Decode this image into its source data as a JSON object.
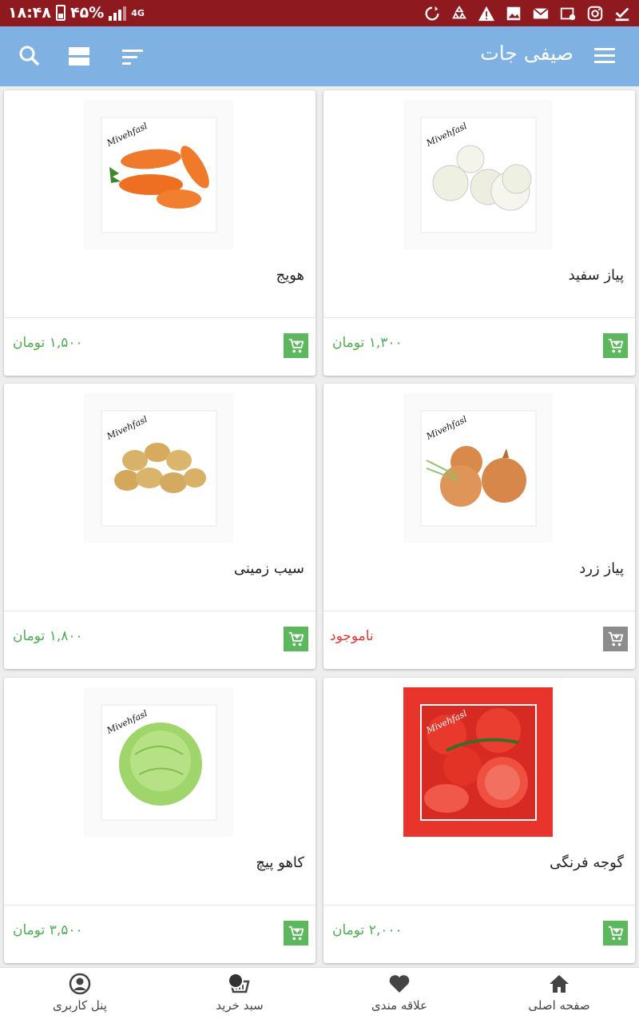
{
  "status_bar": {
    "time": "۱۸:۴۸",
    "battery": "۴۵%",
    "network": "4G"
  },
  "app_bar": {
    "title": "صیفی جات",
    "color": "#7fb2e2"
  },
  "products": [
    {
      "name": "هویج",
      "price": "۱,۵۰۰ تومان",
      "available": true,
      "watermark": "Mivehfasl",
      "icon": "carrot-image"
    },
    {
      "name": "پیاز سفید",
      "price": "۱,۳۰۰ تومان",
      "available": true,
      "watermark": "Mivehfasl",
      "icon": "white-onion-image"
    },
    {
      "name": "سیب زمینی",
      "price": "۱,۸۰۰ تومان",
      "available": true,
      "watermark": "Mivehfasl",
      "icon": "potato-image"
    },
    {
      "name": "پیاز زرد",
      "price": "ناموجود",
      "available": false,
      "watermark": "Mivehfasl",
      "icon": "yellow-onion-image"
    },
    {
      "name": "کاهو پیچ",
      "price": "۳,۵۰۰ تومان",
      "available": true,
      "watermark": "Mivehfasl",
      "icon": "lettuce-image"
    },
    {
      "name": "گوجه فرنگی",
      "price": "۲,۰۰۰ تومان",
      "available": true,
      "watermark": "Mivehfasl",
      "icon": "tomato-image"
    }
  ],
  "bottom_nav": {
    "home": "صفحه اصلی",
    "favorites": "علاقه مندی",
    "cart": "سبد خرید",
    "profile": "پنل کاربری"
  },
  "colors": {
    "status_bar": "#8e1a1f",
    "price": "#4caf50",
    "out_of_stock": "#e53935",
    "cart_button": "#5cb85c",
    "cart_button_disabled": "#8c8c8c"
  }
}
